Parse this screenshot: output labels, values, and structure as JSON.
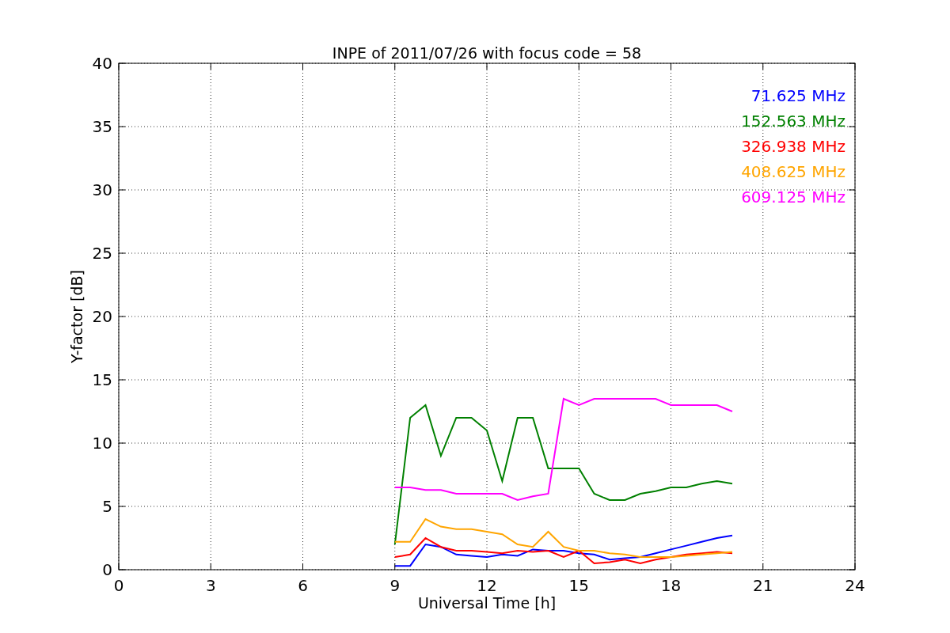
{
  "chart_data": {
    "type": "line",
    "title": "INPE of 2011/07/26 with focus code = 58",
    "xlabel": "Universal Time [h]",
    "ylabel": "Y-factor [dB]",
    "x": [
      9,
      9.5,
      10,
      10.5,
      11,
      11.5,
      12,
      12.5,
      13,
      13.5,
      14,
      14.5,
      15,
      15.5,
      16,
      16.5,
      17,
      17.5,
      18,
      18.5,
      19,
      19.5,
      20
    ],
    "series": [
      {
        "name": "71.625 MHz",
        "color": "#0000ff",
        "values": [
          0.3,
          0.3,
          2,
          1.8,
          1.2,
          1.1,
          1.0,
          1.2,
          1.1,
          1.6,
          1.5,
          1.5,
          1.3,
          1.2,
          0.8,
          0.9,
          1.0,
          1.3,
          1.6,
          1.9,
          2.2,
          2.5,
          2.7
        ]
      },
      {
        "name": "152.563 MHz",
        "color": "#008000",
        "values": [
          2,
          12,
          13,
          9,
          12,
          12,
          11,
          7,
          12,
          12,
          8,
          8,
          8,
          6,
          5.5,
          5.5,
          6,
          6.2,
          6.5,
          6.5,
          6.8,
          7,
          6.8
        ]
      },
      {
        "name": "326.938 MHz",
        "color": "#ff0000",
        "values": [
          1,
          1.2,
          2.5,
          1.8,
          1.5,
          1.5,
          1.4,
          1.3,
          1.5,
          1.4,
          1.5,
          1.0,
          1.5,
          0.5,
          0.6,
          0.8,
          0.5,
          0.8,
          1.0,
          1.2,
          1.3,
          1.4,
          1.3
        ]
      },
      {
        "name": "408.625 MHz",
        "color": "#ffa500",
        "values": [
          2.2,
          2.2,
          4,
          3.4,
          3.2,
          3.2,
          3,
          2.8,
          2,
          1.8,
          3,
          1.8,
          1.5,
          1.5,
          1.3,
          1.2,
          1.0,
          1.0,
          1.0,
          1.1,
          1.2,
          1.3,
          1.4
        ]
      },
      {
        "name": "609.125 MHz",
        "color": "#ff00ff",
        "values": [
          6.5,
          6.5,
          6.3,
          6.3,
          6,
          6,
          6,
          6,
          5.5,
          5.8,
          6,
          13.5,
          13,
          13.5,
          13.5,
          13.5,
          13.5,
          13.5,
          13,
          13,
          13,
          13,
          12.5
        ]
      }
    ],
    "grid": true,
    "xlim": [
      0,
      24
    ],
    "ylim": [
      0,
      40
    ],
    "xticks": [
      0,
      3,
      6,
      9,
      12,
      15,
      18,
      21,
      24
    ],
    "yticks": [
      0,
      5,
      10,
      15,
      20,
      25,
      30,
      35,
      40
    ]
  }
}
